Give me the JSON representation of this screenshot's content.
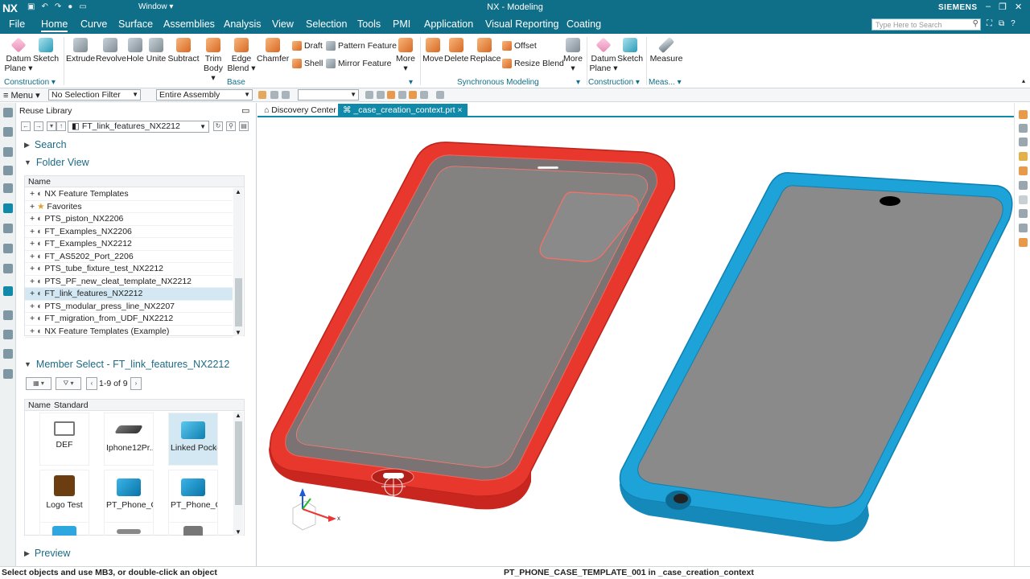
{
  "titlebar": {
    "logo": "NX",
    "window_menu": "Window",
    "title": "NX - Modeling",
    "brand": "SIEMENS",
    "icons": [
      "save-icon",
      "undo-icon",
      "redo-icon",
      "mic-icon",
      "window-icon"
    ]
  },
  "tabs": [
    "File",
    "Home",
    "Curve",
    "Surface",
    "Assemblies",
    "Analysis",
    "View",
    "Selection",
    "Tools",
    "PMI",
    "Application",
    "Visual Reporting",
    "Coating"
  ],
  "active_tab": "Home",
  "search": {
    "placeholder": "Type Here to Search"
  },
  "ribbon": {
    "datum_plane": "Datum Plane",
    "sketch": "Sketch",
    "extrude": "Extrude",
    "revolve": "Revolve",
    "hole": "Hole",
    "unite": "Unite",
    "subtract": "Subtract",
    "trim_body": "Trim Body",
    "edge_blend": "Edge Blend",
    "chamfer": "Chamfer",
    "draft": "Draft",
    "shell": "Shell",
    "pattern_feature": "Pattern Feature",
    "mirror_feature": "Mirror Feature",
    "more": "More",
    "move": "Move",
    "delete": "Delete",
    "replace": "Replace",
    "offset": "Offset",
    "resize_blend": "Resize Blend",
    "more2": "More",
    "datum_plane2": "Datum Plane",
    "sketch2": "Sketch",
    "measure": "Measure",
    "groups": {
      "construction": "Construction",
      "base": "Base",
      "synchronous": "Synchronous Modeling",
      "construction2": "Construction",
      "measure": "Meas..."
    }
  },
  "toolbar2": {
    "menu": "Menu",
    "filter": "No Selection Filter",
    "scope": "Entire Assembly"
  },
  "panel": {
    "title": "Reuse Library",
    "path": "FT_link_features_NX2212",
    "search": "Search",
    "folder_view": "Folder View",
    "tree_header": "Name",
    "tree": [
      "NX Feature Templates",
      "Favorites",
      "PTS_piston_NX2206",
      "FT_Examples_NX2206",
      "FT_Examples_NX2212",
      "FT_AS5202_Port_2206",
      "PTS_tube_fixture_test_NX2212",
      "PTS_PF_new_cleat_template_NX2212",
      "FT_link_features_NX2212",
      "PTS_modular_press_line_NX2207",
      "FT_migration_from_UDF_NX2212",
      "NX Feature Templates (Example)"
    ],
    "selected_index": 8,
    "member_select": "Member Select - FT_link_features_NX2212",
    "count": "1-9 of 9",
    "grid_headers": [
      "Name",
      "Standard"
    ],
    "members": [
      "DEF",
      "Iphone12Pr...",
      "Linked Pocket",
      "Logo Test",
      "PT_Phone_C...",
      "PT_Phone_C..."
    ],
    "preview": "Preview"
  },
  "graphics": {
    "tabs": [
      "Discovery Center",
      "_case_creation_context.prt"
    ],
    "active_tab": 1,
    "close": "×",
    "triad_x": "x"
  },
  "colors": {
    "accent": "#0f6e88",
    "case_red": "#e8372c",
    "case_blue": "#1ea3d8",
    "screen_gray": "#8a8a8a"
  },
  "status": {
    "left": "Select objects and use MB3, or double-click an object",
    "right": "PT_PHONE_CASE_TEMPLATE_001 in _case_creation_context"
  }
}
